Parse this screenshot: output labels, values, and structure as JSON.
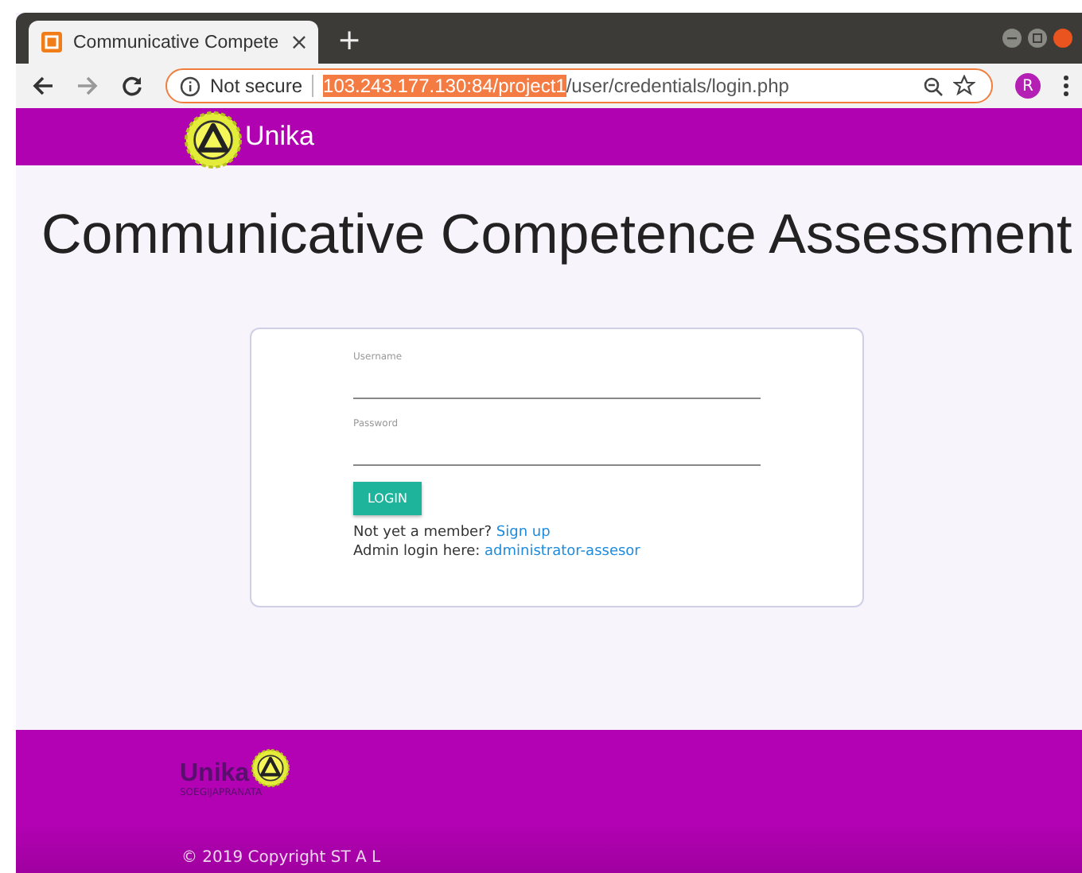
{
  "browser": {
    "tab": {
      "title": "Communicative Compete",
      "close": "×"
    },
    "new_tab": "+",
    "address_bar": {
      "security": "Not secure",
      "url_selected": "103.243.177.130:84/project1",
      "url_rest": "/user/credentials/login.php"
    },
    "profile": "R"
  },
  "navbar": {
    "brand": "Unika"
  },
  "heading": "Communicative Competence Assessment",
  "login_form": {
    "fields": [
      {
        "label": "Username"
      },
      {
        "label": "Password"
      }
    ],
    "button": "LOGIN",
    "links": [
      {
        "text": "Not yet a member?",
        "link": "Sign up"
      },
      {
        "text": "Admin login here:",
        "link": "administrator-assesor"
      }
    ]
  },
  "footer": {
    "logo_text": "Unika",
    "logo_subtext": "SOEGIJAPRANATA",
    "copyright": "© 2019 Copyright ST A L"
  }
}
